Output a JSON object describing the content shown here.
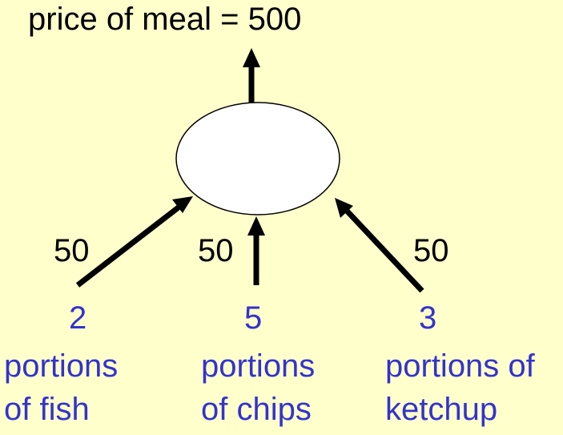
{
  "colors": {
    "background": "#ffffcc",
    "text": "#000000",
    "input_text": "#3333cc",
    "neuron_fill": "#ffffff",
    "arrow": "#000000"
  },
  "output": {
    "label": "price of meal = 500"
  },
  "inputs": [
    {
      "weight": "50",
      "quantity": "2",
      "line1": "portions",
      "line2": "of fish"
    },
    {
      "weight": "50",
      "quantity": "5",
      "line1": "portions",
      "line2": "of chips"
    },
    {
      "weight": "50",
      "quantity": "3",
      "line1": "portions of",
      "line2": "ketchup"
    }
  ]
}
